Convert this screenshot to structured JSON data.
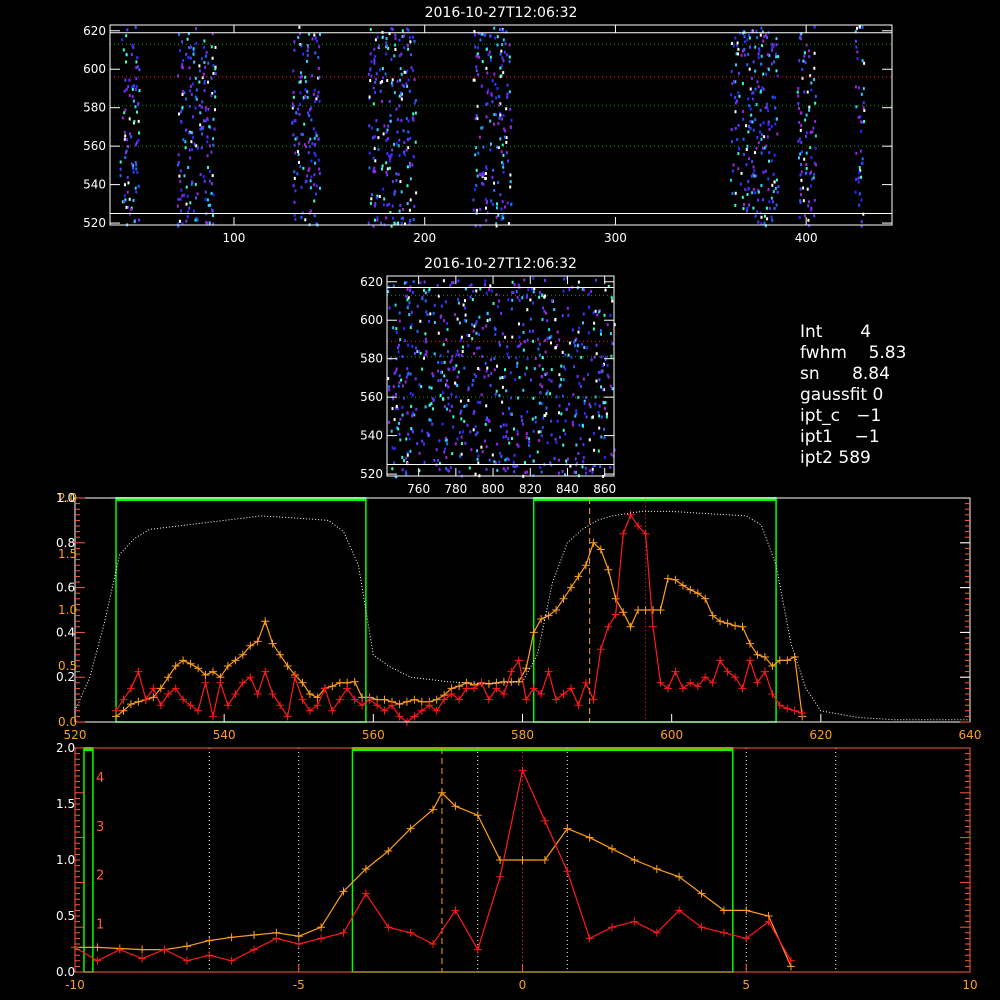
{
  "colors": {
    "background": "#000000",
    "axis": "#ffffff",
    "orange": "#ff9f1c",
    "red": "#ff1a1a",
    "green": "#00ff00",
    "tick_red": "#ff5a3c",
    "dotted_green": "#1aa01a"
  },
  "info_panel": {
    "rows": [
      {
        "label": "Int",
        "value": "4"
      },
      {
        "label": "fwhm",
        "value": "5.83"
      },
      {
        "label": "sn",
        "value": "8.84"
      },
      {
        "label": "gaussfit",
        "value": "0"
      },
      {
        "label": "ipt_c",
        "value": "−1"
      },
      {
        "label": "ipt1",
        "value": "−1"
      },
      {
        "label": "ipt2",
        "value": "589"
      }
    ]
  },
  "chart_data": [
    {
      "type": "heatmap",
      "title": "2016-10-27T12:06:32",
      "xlabel": "",
      "ylabel": "",
      "xlim": [
        35,
        445
      ],
      "ylim": [
        519,
        623
      ],
      "xticks": [
        100,
        200,
        300,
        400
      ],
      "yticks": [
        520,
        540,
        560,
        580,
        600,
        620
      ],
      "hlines_white": [
        525,
        619
      ],
      "hlines_green_dotted": [
        560,
        581,
        613
      ],
      "hline_red_dotted": 596,
      "activity_columns": [
        [
          40,
          50
        ],
        [
          70,
          90
        ],
        [
          130,
          145
        ],
        [
          170,
          195
        ],
        [
          225,
          245
        ],
        [
          360,
          385
        ],
        [
          395,
          405
        ],
        [
          425,
          430
        ]
      ]
    },
    {
      "type": "heatmap",
      "title": "2016-10-27T12:06:32",
      "xlabel": "",
      "ylabel": "",
      "xlim": [
        743,
        865
      ],
      "ylim": [
        519,
        623
      ],
      "xticks": [
        760,
        780,
        800,
        820,
        840,
        860
      ],
      "yticks": [
        520,
        540,
        560,
        580,
        600,
        620
      ],
      "hlines_white": [
        525,
        617
      ],
      "hlines_green_dotted": [
        560,
        581,
        613
      ],
      "hline_red_dotted": 589
    },
    {
      "type": "line",
      "title": "",
      "xlabel": "",
      "ylabel": "",
      "xlim": [
        520,
        640
      ],
      "xticks": [
        520,
        540,
        560,
        580,
        600,
        620,
        640
      ],
      "ylim_left_orange": [
        0,
        2.0
      ],
      "yticks_left_orange": [
        "0.0",
        "0.5",
        "1.0",
        "1.5",
        "2.0"
      ],
      "ylim_left_white": [
        0,
        1.0
      ],
      "yticks_left_white": [
        "0.2",
        "0.4",
        "0.6",
        "0.8",
        "1.0"
      ],
      "green_windows": [
        [
          525.5,
          559.0
        ],
        [
          581.5,
          614.0
        ]
      ],
      "vline_orange_dashed": 589,
      "vline_red_dotted": 596.5,
      "series": [
        {
          "color": "orange",
          "x": [
            525.5,
            526.5,
            527.5,
            528.5,
            529.5,
            530.5,
            531.5,
            532.5,
            533.5,
            534.5,
            535.5,
            536.5,
            537.5,
            538.5,
            539.5,
            540.5,
            541.5,
            542.5,
            543.5,
            544.5,
            545.5,
            546.5,
            547.5,
            548.5,
            549.5,
            550.5,
            551.5,
            552.5,
            553.5,
            554.5,
            555.5,
            556.5,
            557.5,
            558.5,
            559.5,
            560.5,
            561.5,
            562.5,
            563.5,
            564.5,
            565.5,
            566.5,
            567.5,
            568.5,
            569.5,
            570.5,
            571.5,
            572.5,
            573.5,
            574.5,
            575.5,
            576.5,
            577.5,
            578.5,
            579.5,
            580.5,
            581.5,
            582.5,
            583.5,
            584.5,
            585.5,
            586.5,
            587.5,
            588.5,
            589.5,
            590.5,
            591.5,
            592.5,
            593.5,
            594.5,
            595.5,
            596.5,
            597.5,
            598.5,
            599.5,
            600.5,
            601.5,
            602.5,
            603.5,
            604.5,
            605.5,
            606.5,
            607.5,
            608.5,
            609.5,
            610.5,
            611.5,
            612.5,
            613.5,
            614.5,
            615.5,
            616.5,
            617.5
          ],
          "y": [
            0.05,
            0.1,
            0.16,
            0.18,
            0.2,
            0.22,
            0.3,
            0.4,
            0.5,
            0.55,
            0.52,
            0.48,
            0.42,
            0.45,
            0.4,
            0.5,
            0.55,
            0.6,
            0.68,
            0.72,
            0.9,
            0.7,
            0.6,
            0.5,
            0.42,
            0.35,
            0.25,
            0.22,
            0.3,
            0.32,
            0.35,
            0.35,
            0.36,
            0.22,
            0.22,
            0.2,
            0.2,
            0.18,
            0.16,
            0.18,
            0.2,
            0.18,
            0.18,
            0.2,
            0.24,
            0.3,
            0.32,
            0.35,
            0.33,
            0.35,
            0.34,
            0.35,
            0.36,
            0.36,
            0.36,
            0.48,
            0.8,
            0.92,
            0.95,
            1.0,
            1.1,
            1.2,
            1.3,
            1.4,
            1.6,
            1.54,
            1.36,
            1.1,
            0.98,
            0.85,
            1.0,
            1.0,
            1.0,
            1.0,
            1.28,
            1.27,
            1.22,
            1.18,
            1.15,
            1.1,
            0.95,
            0.9,
            0.88,
            0.86,
            0.85,
            0.7,
            0.6,
            0.58,
            0.5,
            0.55,
            0.55,
            0.58,
            0.05
          ]
        },
        {
          "color": "red",
          "x": [
            525.5,
            526.5,
            527.5,
            528.5,
            529.5,
            530.5,
            531.5,
            532.5,
            533.5,
            534.5,
            535.5,
            536.5,
            537.5,
            538.5,
            539.5,
            540.5,
            541.5,
            542.5,
            543.5,
            544.5,
            545.5,
            546.5,
            547.5,
            548.5,
            549.5,
            550.5,
            551.5,
            552.5,
            553.5,
            554.5,
            555.5,
            556.5,
            557.5,
            558.5,
            559.5,
            560.5,
            561.5,
            562.5,
            563.5,
            564.5,
            565.5,
            566.5,
            567.5,
            568.5,
            569.5,
            570.5,
            571.5,
            572.5,
            573.5,
            574.5,
            575.5,
            576.5,
            577.5,
            578.5,
            579.5,
            580.5,
            581.5,
            582.5,
            583.5,
            584.5,
            585.5,
            586.5,
            587.5,
            588.5,
            589.5,
            590.5,
            591.5,
            592.5,
            593.5,
            594.5,
            595.5,
            596.5,
            597.5,
            598.5,
            599.5,
            600.5,
            601.5,
            602.5,
            603.5,
            604.5,
            605.5,
            606.5,
            607.5,
            608.5,
            609.5,
            610.5,
            611.5,
            612.5,
            613.5,
            614.5,
            615.5,
            616.5,
            617.5
          ],
          "y": [
            0.1,
            0.2,
            0.3,
            0.45,
            0.2,
            0.3,
            0.15,
            0.25,
            0.3,
            0.2,
            0.15,
            0.1,
            0.35,
            0.05,
            0.35,
            0.15,
            0.25,
            0.35,
            0.4,
            0.25,
            0.45,
            0.25,
            0.15,
            0.05,
            0.4,
            0.2,
            0.1,
            0.15,
            0.3,
            0.1,
            0.2,
            0.3,
            0.2,
            0.15,
            0.2,
            0.15,
            0.1,
            0.15,
            0.05,
            0.0,
            0.05,
            0.1,
            0.15,
            0.1,
            0.2,
            0.25,
            0.2,
            0.3,
            0.3,
            0.35,
            0.2,
            0.3,
            0.25,
            0.45,
            0.55,
            0.2,
            0.3,
            0.25,
            0.45,
            0.2,
            0.25,
            0.3,
            0.15,
            0.35,
            0.2,
            0.65,
            0.85,
            0.96,
            1.68,
            1.85,
            1.75,
            1.68,
            0.85,
            0.35,
            0.3,
            0.45,
            0.3,
            0.35,
            0.32,
            0.4,
            0.35,
            0.55,
            0.45,
            0.4,
            0.3,
            0.55,
            0.35,
            0.45,
            0.25,
            0.15,
            0.12,
            0.1,
            0.08
          ]
        },
        {
          "color": "white-dotted",
          "x": [
            520,
            522,
            524,
            526,
            528,
            530,
            535,
            540,
            545,
            550,
            554,
            556,
            558,
            560,
            562,
            565,
            570,
            575,
            580,
            582,
            584,
            586,
            588,
            590,
            592,
            596,
            600,
            605,
            610,
            612,
            614,
            616,
            618,
            620,
            625,
            630,
            635,
            640
          ],
          "y": [
            0.05,
            0.2,
            0.45,
            0.75,
            0.82,
            0.86,
            0.88,
            0.9,
            0.92,
            0.91,
            0.9,
            0.85,
            0.7,
            0.3,
            0.25,
            0.2,
            0.18,
            0.17,
            0.18,
            0.3,
            0.62,
            0.8,
            0.86,
            0.9,
            0.92,
            0.94,
            0.94,
            0.93,
            0.92,
            0.88,
            0.7,
            0.35,
            0.15,
            0.05,
            0.02,
            0.01,
            0.01,
            0.01
          ]
        }
      ]
    },
    {
      "type": "line",
      "title": "",
      "xlabel": "",
      "ylabel": "",
      "xlim": [
        -10,
        10
      ],
      "xticks": [
        -10,
        -5,
        0,
        5,
        10
      ],
      "ylim_left": [
        0,
        2.0
      ],
      "yticks_left": [
        "0.0",
        "0.5",
        "1.0",
        "1.5",
        "2.0"
      ],
      "yticks_red": [
        "1",
        "2",
        "3",
        "4"
      ],
      "green_windows": [
        [
          -9.8,
          -9.6
        ],
        [
          -3.8,
          4.7
        ]
      ],
      "vline_orange_dashed": -1.8,
      "vlines_white_dotted": [
        -7,
        -5,
        -1,
        1,
        5,
        7
      ],
      "vline_red_dotted": 0,
      "series": [
        {
          "color": "orange",
          "x": [
            -10,
            -9.5,
            -9.0,
            -8.5,
            -8.0,
            -7.5,
            -7.0,
            -6.5,
            -6.0,
            -5.5,
            -5.0,
            -4.5,
            -4.0,
            -3.5,
            -3.0,
            -2.5,
            -2.0,
            -1.8,
            -1.5,
            -1.0,
            -0.5,
            0.0,
            0.5,
            1.0,
            1.5,
            2.0,
            2.5,
            3.0,
            3.5,
            4.0,
            4.5,
            5.0,
            5.5,
            6.0
          ],
          "y": [
            0.22,
            0.22,
            0.21,
            0.2,
            0.2,
            0.23,
            0.28,
            0.31,
            0.33,
            0.35,
            0.32,
            0.4,
            0.72,
            0.92,
            1.08,
            1.28,
            1.45,
            1.6,
            1.48,
            1.4,
            1.0,
            1.0,
            1.0,
            1.28,
            1.2,
            1.1,
            1.0,
            0.92,
            0.85,
            0.7,
            0.55,
            0.55,
            0.5,
            0.05
          ]
        },
        {
          "color": "red",
          "x": [
            -10,
            -9.5,
            -9.0,
            -8.5,
            -8.0,
            -7.5,
            -7.0,
            -6.5,
            -6.0,
            -5.5,
            -5.0,
            -4.5,
            -4.0,
            -3.5,
            -3.0,
            -2.5,
            -2.0,
            -1.5,
            -1.0,
            -0.5,
            0.0,
            0.5,
            1.0,
            1.5,
            2.0,
            2.5,
            3.0,
            3.5,
            4.0,
            4.5,
            5.0,
            5.5,
            6.0
          ],
          "y": [
            0.22,
            0.1,
            0.2,
            0.12,
            0.2,
            0.1,
            0.15,
            0.1,
            0.2,
            0.3,
            0.25,
            0.3,
            0.35,
            0.7,
            0.4,
            0.35,
            0.25,
            0.55,
            0.2,
            0.85,
            1.8,
            1.35,
            0.9,
            0.3,
            0.4,
            0.45,
            0.35,
            0.55,
            0.4,
            0.35,
            0.3,
            0.45,
            0.1
          ]
        }
      ]
    }
  ]
}
